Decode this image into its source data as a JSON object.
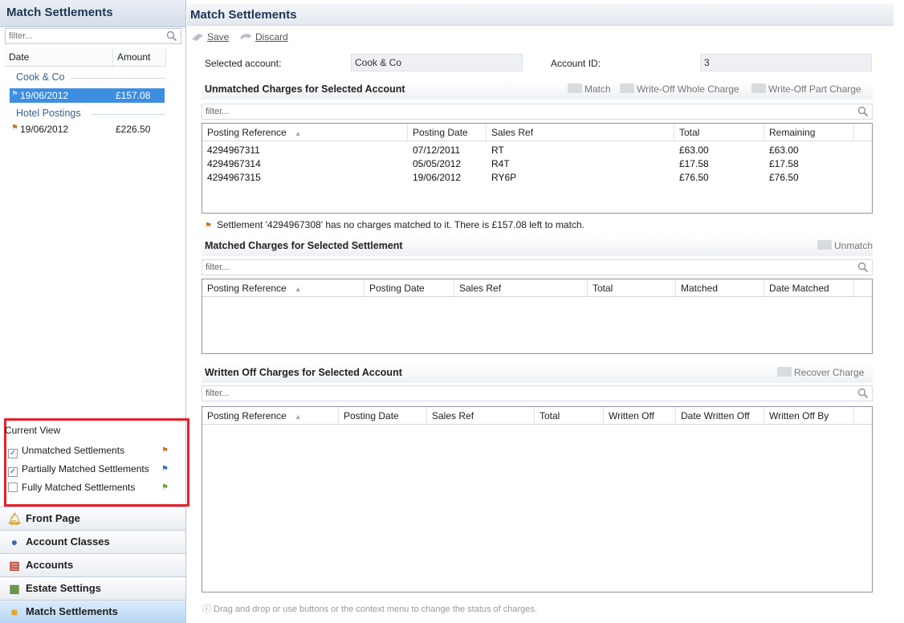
{
  "left": {
    "title": "Match Settlements",
    "filter_placeholder": "filter...",
    "headers": {
      "date": "Date",
      "amount": "Amount"
    },
    "groups": [
      {
        "name": "Cook & Co",
        "rows": [
          {
            "date": "19/06/2012",
            "amount": "£157.08"
          }
        ]
      },
      {
        "name": "Hotel Postings",
        "rows": [
          {
            "date": "19/06/2012",
            "amount": "£226.50"
          }
        ]
      }
    ],
    "current_view": {
      "title": "Current View",
      "options": [
        {
          "label": "Unmatched Settlements",
          "checked": true,
          "flag_color": "#c8761e"
        },
        {
          "label": "Partially Matched Settlements",
          "checked": true,
          "flag_color": "#3d6fbf"
        },
        {
          "label": "Fully Matched Settlements",
          "checked": false,
          "flag_color": "#6aa12f"
        }
      ]
    },
    "nav": [
      {
        "label": "Front Page",
        "icon": "bell-icon",
        "selected": false
      },
      {
        "label": "Account Classes",
        "icon": "user-group-icon",
        "selected": false
      },
      {
        "label": "Accounts",
        "icon": "ledger-icon",
        "selected": false
      },
      {
        "label": "Estate Settings",
        "icon": "estate-icon",
        "selected": false
      },
      {
        "label": "Match Settlements",
        "icon": "match-icon",
        "selected": true
      }
    ]
  },
  "main": {
    "title": "Match Settlements",
    "toolbar": {
      "save": "Save",
      "discard": "Discard"
    },
    "selected_account_label": "Selected account:",
    "selected_account_value": "Cook & Co",
    "account_id_label": "Account ID:",
    "account_id_value": "3",
    "unmatched": {
      "title": "Unmatched Charges for Selected Account",
      "buttons": {
        "match": "Match",
        "write_off_whole": "Write-Off Whole Charge",
        "write_off_part": "Write-Off Part Charge"
      },
      "filter_placeholder": "filter...",
      "columns": [
        "Posting Reference",
        "Posting Date",
        "Sales Ref",
        "Total",
        "Remaining"
      ],
      "rows": [
        [
          "4294967311",
          "07/12/2011",
          "RT",
          "£63.00",
          "£63.00"
        ],
        [
          "4294967314",
          "05/05/2012",
          "R4T",
          "£17.58",
          "£17.58"
        ],
        [
          "4294967315",
          "19/06/2012",
          "RY6P",
          "£76.50",
          "£76.50"
        ]
      ]
    },
    "settlement_message": "Settlement '4294967308' has no charges matched to it. There is £157.08 left to match.",
    "matched": {
      "title": "Matched Charges for Selected Settlement",
      "buttons": {
        "unmatch": "Unmatch"
      },
      "filter_placeholder": "filter...",
      "columns": [
        "Posting Reference",
        "Posting Date",
        "Sales Ref",
        "Total",
        "Matched",
        "Date Matched"
      ]
    },
    "written_off": {
      "title": "Written Off Charges for Selected Account",
      "buttons": {
        "recover": "Recover Charge"
      },
      "filter_placeholder": "filter...",
      "columns": [
        "Posting Reference",
        "Posting Date",
        "Sales Ref",
        "Total",
        "Written Off",
        "Date Written Off",
        "Written Off By"
      ]
    },
    "footer_hint": "Drag and drop or use buttons or the context menu to change the status of charges."
  }
}
